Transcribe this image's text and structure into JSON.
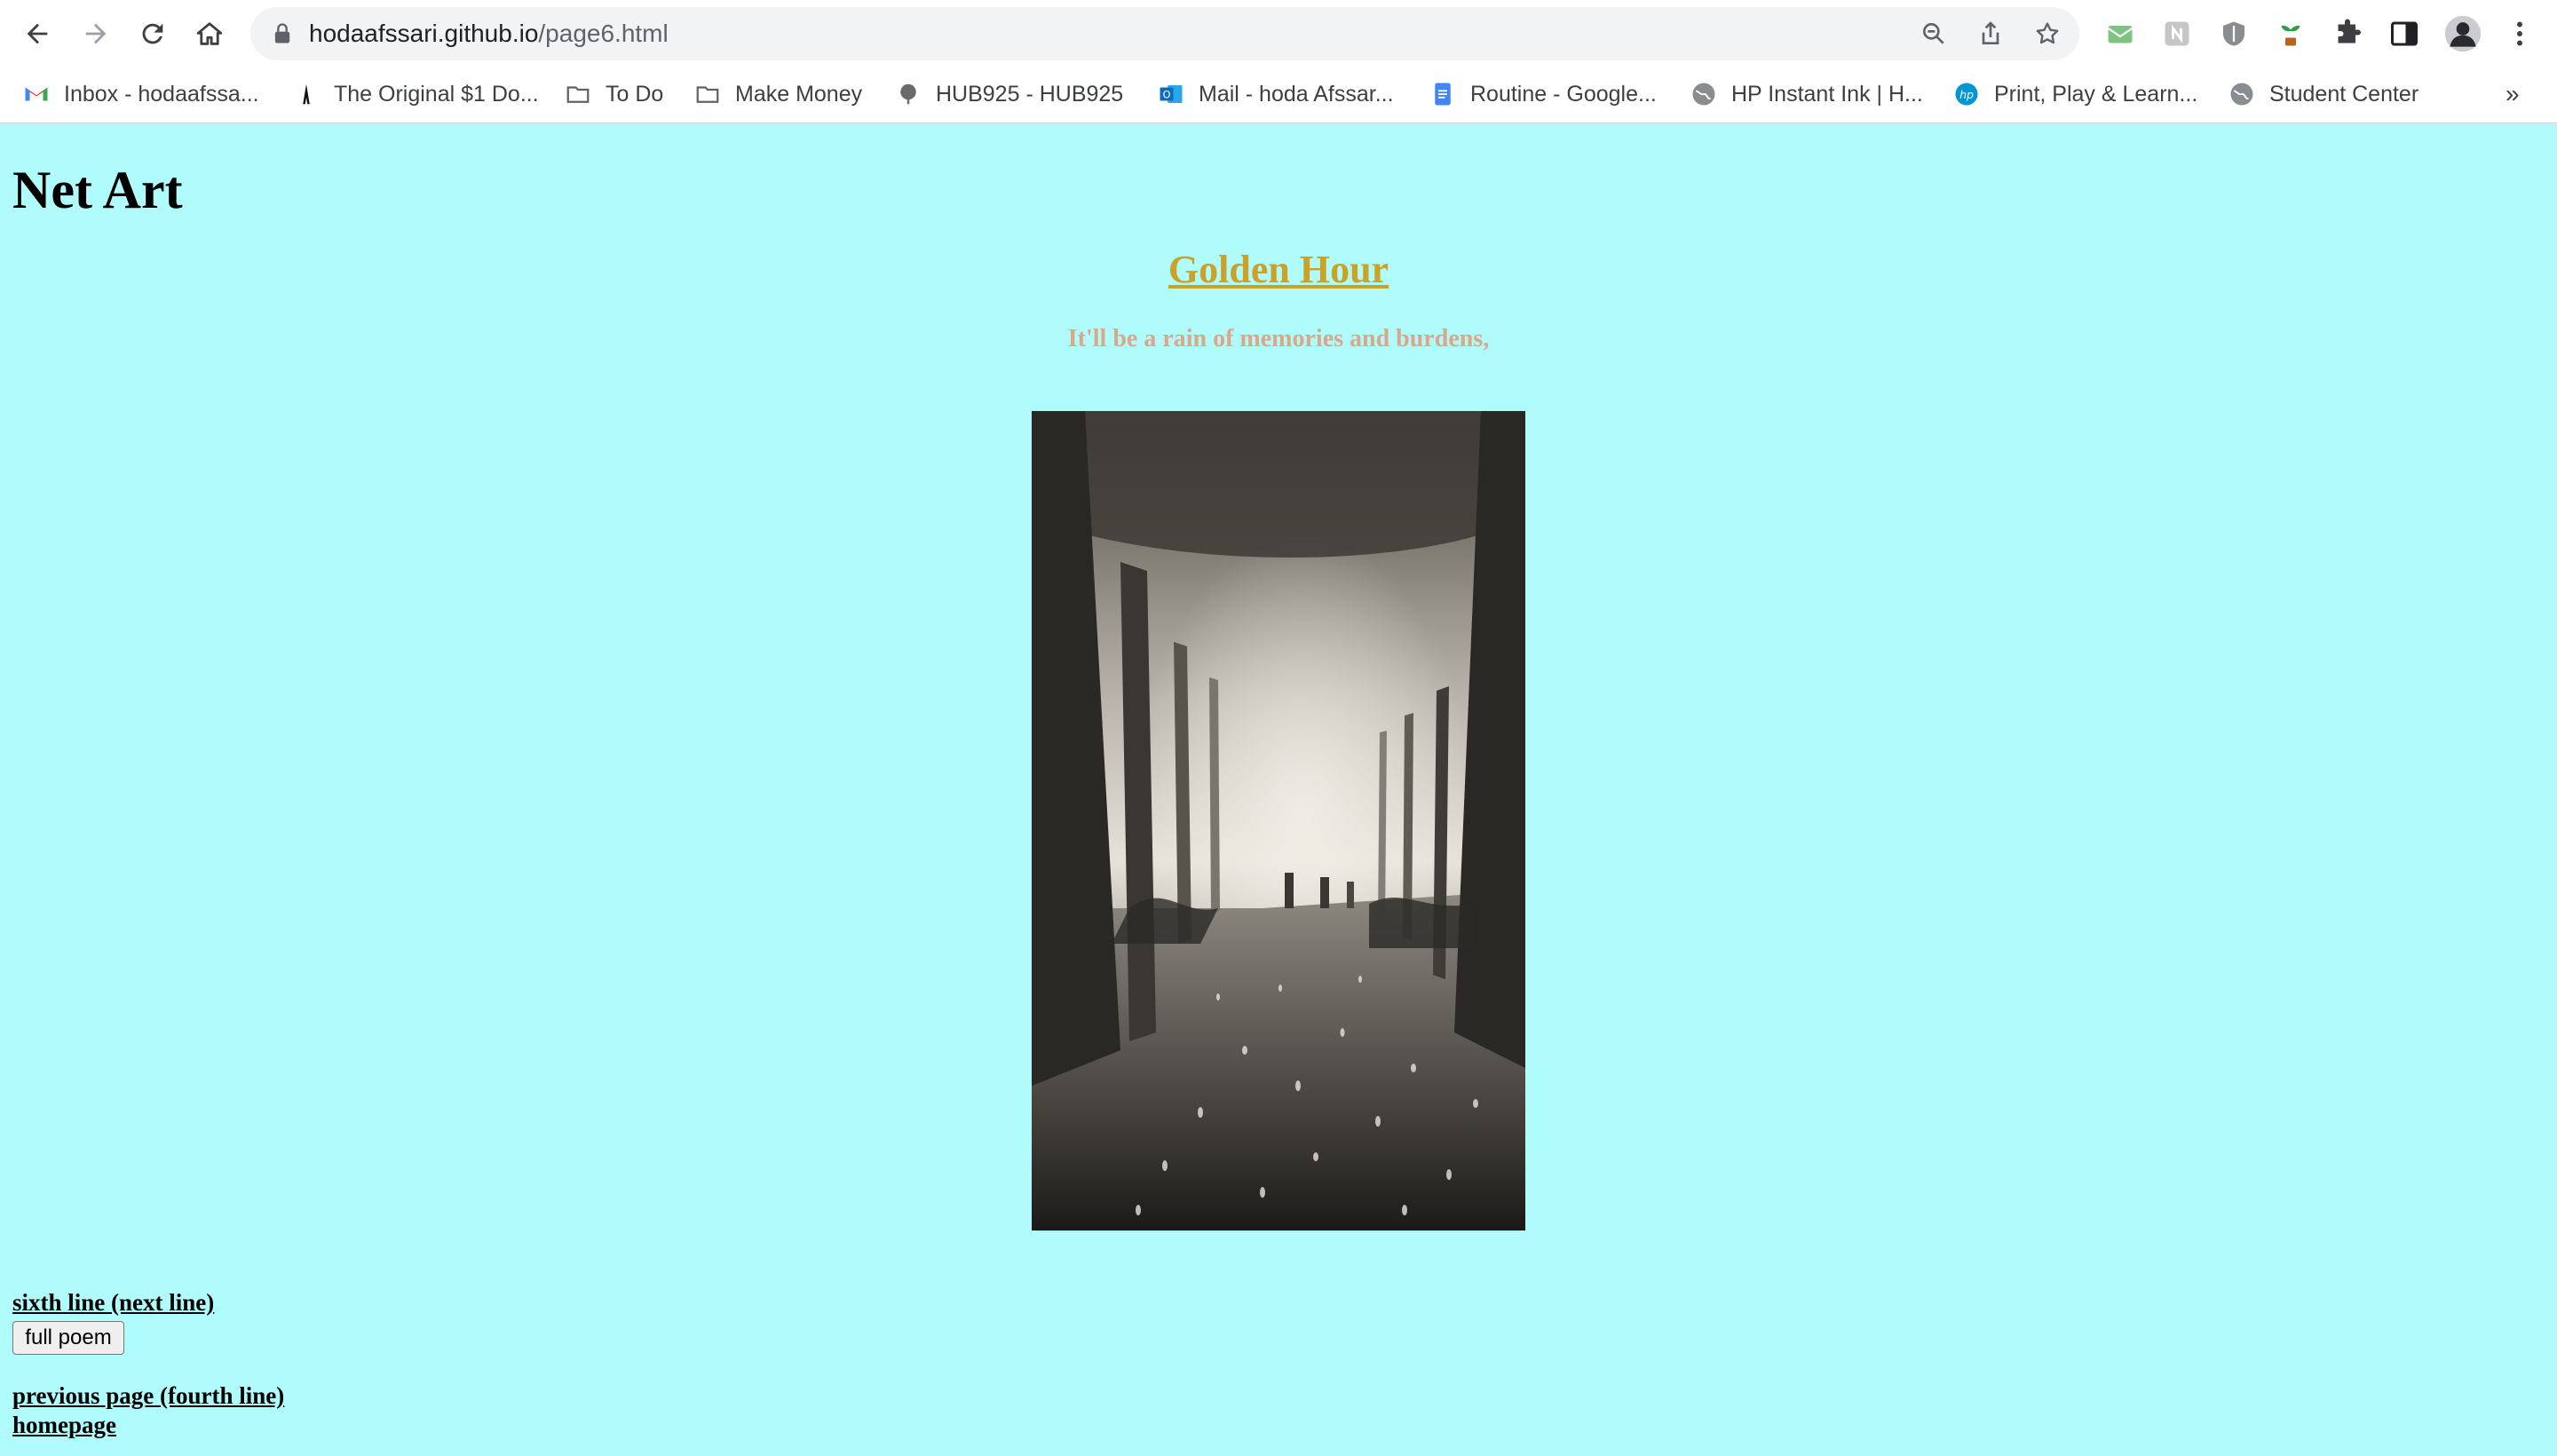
{
  "browser": {
    "url_host": "hodaafssari.github.io",
    "url_path": "/page6.html",
    "bookmarks": [
      {
        "label": "Inbox - hodaafssa...",
        "icon": "gmail-icon"
      },
      {
        "label": "The Original $1 Do...",
        "icon": "site-icon"
      },
      {
        "label": "To Do",
        "icon": "folder-icon"
      },
      {
        "label": "Make Money",
        "icon": "folder-icon"
      },
      {
        "label": "HUB925 - HUB925",
        "icon": "site-icon"
      },
      {
        "label": "Mail - hoda Afssar...",
        "icon": "outlook-icon"
      },
      {
        "label": "Routine - Google...",
        "icon": "docs-icon"
      },
      {
        "label": "HP Instant Ink | H...",
        "icon": "globe-icon"
      },
      {
        "label": "Print, Play & Learn...",
        "icon": "hp-icon"
      },
      {
        "label": "Student Center",
        "icon": "globe-icon"
      }
    ],
    "overflow_label": "»"
  },
  "page": {
    "heading": "Net Art",
    "title": "Golden Hour",
    "line": "It'll be a rain of memories and burdens,",
    "next_link": "sixth line (next line)",
    "full_poem_button": "full poem",
    "prev_link": "previous page (fourth line)",
    "home_link": "homepage"
  },
  "colors": {
    "background": "#b0fcfc",
    "title": "#c9a227",
    "line": "#d9a78a"
  }
}
